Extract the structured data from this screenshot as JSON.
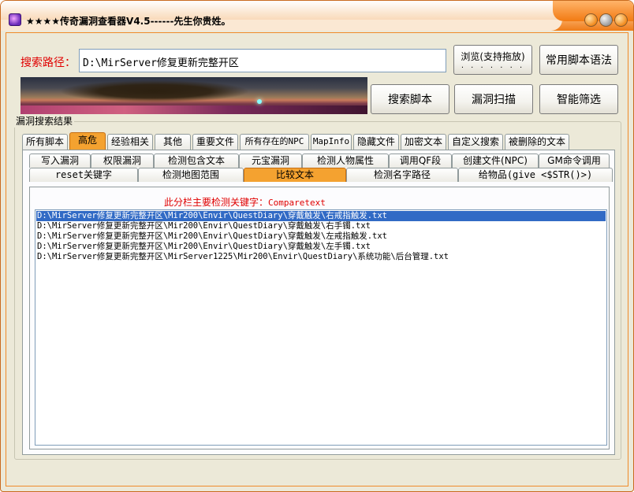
{
  "window": {
    "title": "★★★★传奇漏洞查看器V4.5------先生你贵姓。"
  },
  "search": {
    "label": "搜索路径：",
    "path_value": "D:\\MirServer修复更新完整开区"
  },
  "buttons": {
    "browse_label": "浏览(支持拖放)",
    "browse_dots": ". . . . . . .",
    "syntax_label": "常用脚本语法",
    "search_script_label": "搜索脚本",
    "vuln_scan_label": "漏洞扫描",
    "smart_filter_label": "智能筛选"
  },
  "group": {
    "title": "漏洞搜索结果"
  },
  "main_tabs": [
    {
      "label": "所有脚本"
    },
    {
      "label": "高危"
    },
    {
      "label": "经验相关"
    },
    {
      "label": "其他"
    },
    {
      "label": "重要文件"
    },
    {
      "label": "所有存在的NPC"
    },
    {
      "label": "MapInfo"
    },
    {
      "label": "隐藏文件"
    },
    {
      "label": "加密文本"
    },
    {
      "label": "自定义搜索"
    },
    {
      "label": "被删除的文本"
    }
  ],
  "sub_tabs_row1": [
    {
      "label": "写入漏洞"
    },
    {
      "label": "权限漏洞"
    },
    {
      "label": "检测包含文本"
    },
    {
      "label": "元宝漏洞"
    },
    {
      "label": "检测人物属性"
    },
    {
      "label": "调用QF段"
    },
    {
      "label": "创建文件(NPC)"
    },
    {
      "label": "GM命令调用"
    }
  ],
  "sub_tabs_row2": [
    {
      "label": "reset关键字"
    },
    {
      "label": "检测地图范围"
    },
    {
      "label": "比较文本"
    },
    {
      "label": "检测名字路径"
    },
    {
      "label": "给物品(give <$STR()>)"
    }
  ],
  "panel": {
    "hint_prefix": "此分栏主要检测关键字：",
    "hint_keyword": "Comparetext"
  },
  "results": [
    "D:\\MirServer修复更新完整开区\\Mir200\\Envir\\QuestDiary\\穿戴触发\\右戒指触发.txt",
    "D:\\MirServer修复更新完整开区\\Mir200\\Envir\\QuestDiary\\穿戴触发\\右手镯.txt",
    "D:\\MirServer修复更新完整开区\\Mir200\\Envir\\QuestDiary\\穿戴触发\\左戒指触发.txt",
    "D:\\MirServer修复更新完整开区\\Mir200\\Envir\\QuestDiary\\穿戴触发\\左手镯.txt",
    "D:\\MirServer修复更新完整开区\\MirServer1225\\Mir200\\Envir\\QuestDiary\\系统功能\\后台管理.txt"
  ],
  "selected_result_index": 0,
  "colors": {
    "accent": "#f4a230",
    "label_red": "#e00000",
    "selection": "#316ac5"
  }
}
